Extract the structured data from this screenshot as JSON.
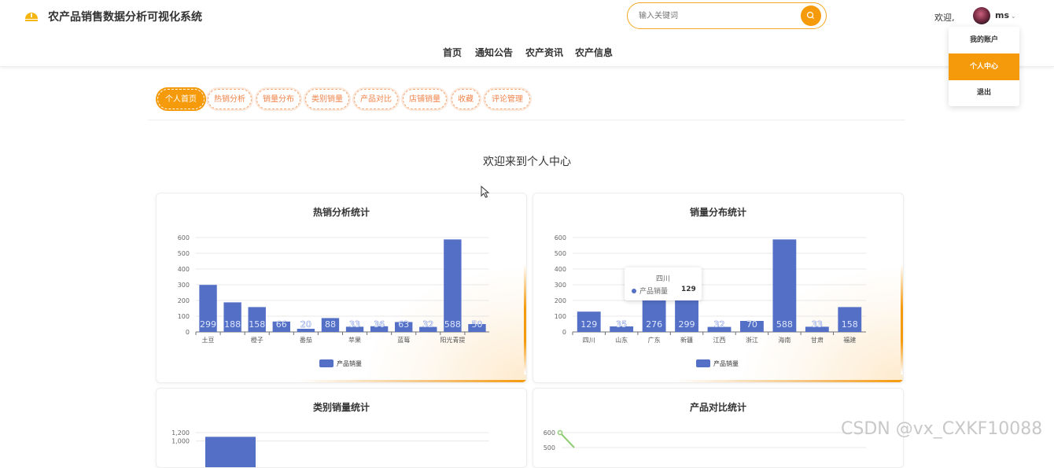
{
  "header": {
    "site_title": "农产品销售数据分析可视化系统",
    "search_placeholder": "输入关键词",
    "welcome": "欢迎,",
    "username": "ms",
    "nav": [
      "首页",
      "通知公告",
      "农产资讯",
      "农产信息"
    ]
  },
  "dropdown": {
    "items": [
      "我的账户",
      "个人中心",
      "退出"
    ],
    "active_index": 1
  },
  "tabs": {
    "items": [
      "个人首页",
      "热销分析",
      "销量分布",
      "类别销量",
      "产品对比",
      "店铺销量",
      "收藏",
      "评论管理"
    ],
    "active_index": 0
  },
  "page": {
    "title": "欢迎来到个人中心"
  },
  "colors": {
    "accent": "#f59a0b",
    "bar": "#5470c6",
    "line": "#91cc75"
  },
  "chart_data": [
    {
      "type": "bar",
      "title": "热销分析统计",
      "categories": [
        "土豆",
        "",
        "橙子",
        "",
        "番茄",
        "",
        "苹果",
        "",
        "蓝莓",
        "",
        "阳光青提",
        ""
      ],
      "series": [
        {
          "name": "产品销量",
          "values": [
            299,
            188,
            158,
            66,
            20,
            88,
            33,
            36,
            63,
            32,
            588,
            50
          ]
        }
      ],
      "ylim": [
        0,
        600
      ],
      "yticks": [
        0,
        100,
        200,
        300,
        400,
        500,
        600
      ],
      "legend": "bottom-center",
      "grid": true
    },
    {
      "type": "bar",
      "title": "销量分布统计",
      "categories": [
        "四川",
        "山东",
        "广东",
        "新疆",
        "江西",
        "浙江",
        "海南",
        "甘肃",
        "福建"
      ],
      "series": [
        {
          "name": "产品销量",
          "values": [
            129,
            35,
            276,
            299,
            32,
            70,
            588,
            33,
            158
          ]
        }
      ],
      "ylim": [
        0,
        600
      ],
      "yticks": [
        0,
        100,
        200,
        300,
        400,
        500,
        600
      ],
      "legend": "bottom-center",
      "grid": true,
      "tooltip": {
        "category": "四川",
        "series": "产品销量",
        "value": "129"
      }
    },
    {
      "type": "bar",
      "title": "类别销量统计",
      "categories": [],
      "series": [
        {
          "name": "",
          "values": [
            1100
          ]
        }
      ],
      "yticks_visible": [
        "1,200",
        "1,000"
      ],
      "ylim": [
        0,
        1200
      ]
    },
    {
      "type": "line",
      "title": "产品对比统计",
      "series": [
        {
          "name": "",
          "values": [
            600,
            500
          ]
        }
      ],
      "yticks_visible": [
        "600",
        "500"
      ],
      "ylim": [
        0,
        600
      ]
    }
  ],
  "watermark": "CSDN @vx_CXKF10088"
}
